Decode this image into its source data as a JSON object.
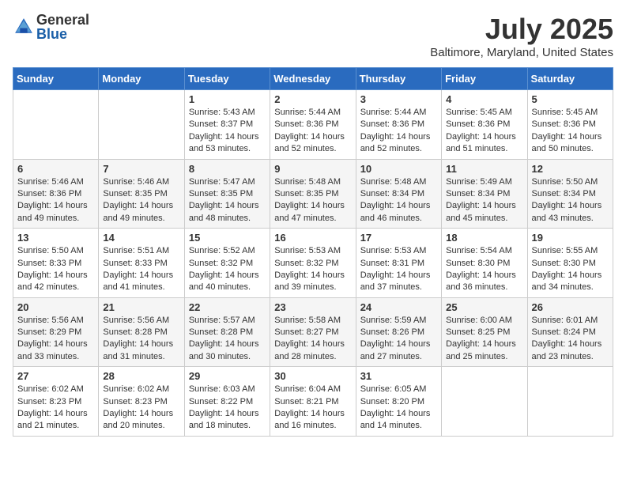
{
  "logo": {
    "general": "General",
    "blue": "Blue"
  },
  "title": "July 2025",
  "location": "Baltimore, Maryland, United States",
  "days_of_week": [
    "Sunday",
    "Monday",
    "Tuesday",
    "Wednesday",
    "Thursday",
    "Friday",
    "Saturday"
  ],
  "weeks": [
    [
      {
        "day": null,
        "sunrise": null,
        "sunset": null,
        "daylight": null
      },
      {
        "day": null,
        "sunrise": null,
        "sunset": null,
        "daylight": null
      },
      {
        "day": "1",
        "sunrise": "5:43 AM",
        "sunset": "8:37 PM",
        "daylight": "14 hours and 53 minutes."
      },
      {
        "day": "2",
        "sunrise": "5:44 AM",
        "sunset": "8:36 PM",
        "daylight": "14 hours and 52 minutes."
      },
      {
        "day": "3",
        "sunrise": "5:44 AM",
        "sunset": "8:36 PM",
        "daylight": "14 hours and 52 minutes."
      },
      {
        "day": "4",
        "sunrise": "5:45 AM",
        "sunset": "8:36 PM",
        "daylight": "14 hours and 51 minutes."
      },
      {
        "day": "5",
        "sunrise": "5:45 AM",
        "sunset": "8:36 PM",
        "daylight": "14 hours and 50 minutes."
      }
    ],
    [
      {
        "day": "6",
        "sunrise": "5:46 AM",
        "sunset": "8:36 PM",
        "daylight": "14 hours and 49 minutes."
      },
      {
        "day": "7",
        "sunrise": "5:46 AM",
        "sunset": "8:35 PM",
        "daylight": "14 hours and 49 minutes."
      },
      {
        "day": "8",
        "sunrise": "5:47 AM",
        "sunset": "8:35 PM",
        "daylight": "14 hours and 48 minutes."
      },
      {
        "day": "9",
        "sunrise": "5:48 AM",
        "sunset": "8:35 PM",
        "daylight": "14 hours and 47 minutes."
      },
      {
        "day": "10",
        "sunrise": "5:48 AM",
        "sunset": "8:34 PM",
        "daylight": "14 hours and 46 minutes."
      },
      {
        "day": "11",
        "sunrise": "5:49 AM",
        "sunset": "8:34 PM",
        "daylight": "14 hours and 45 minutes."
      },
      {
        "day": "12",
        "sunrise": "5:50 AM",
        "sunset": "8:34 PM",
        "daylight": "14 hours and 43 minutes."
      }
    ],
    [
      {
        "day": "13",
        "sunrise": "5:50 AM",
        "sunset": "8:33 PM",
        "daylight": "14 hours and 42 minutes."
      },
      {
        "day": "14",
        "sunrise": "5:51 AM",
        "sunset": "8:33 PM",
        "daylight": "14 hours and 41 minutes."
      },
      {
        "day": "15",
        "sunrise": "5:52 AM",
        "sunset": "8:32 PM",
        "daylight": "14 hours and 40 minutes."
      },
      {
        "day": "16",
        "sunrise": "5:53 AM",
        "sunset": "8:32 PM",
        "daylight": "14 hours and 39 minutes."
      },
      {
        "day": "17",
        "sunrise": "5:53 AM",
        "sunset": "8:31 PM",
        "daylight": "14 hours and 37 minutes."
      },
      {
        "day": "18",
        "sunrise": "5:54 AM",
        "sunset": "8:30 PM",
        "daylight": "14 hours and 36 minutes."
      },
      {
        "day": "19",
        "sunrise": "5:55 AM",
        "sunset": "8:30 PM",
        "daylight": "14 hours and 34 minutes."
      }
    ],
    [
      {
        "day": "20",
        "sunrise": "5:56 AM",
        "sunset": "8:29 PM",
        "daylight": "14 hours and 33 minutes."
      },
      {
        "day": "21",
        "sunrise": "5:56 AM",
        "sunset": "8:28 PM",
        "daylight": "14 hours and 31 minutes."
      },
      {
        "day": "22",
        "sunrise": "5:57 AM",
        "sunset": "8:28 PM",
        "daylight": "14 hours and 30 minutes."
      },
      {
        "day": "23",
        "sunrise": "5:58 AM",
        "sunset": "8:27 PM",
        "daylight": "14 hours and 28 minutes."
      },
      {
        "day": "24",
        "sunrise": "5:59 AM",
        "sunset": "8:26 PM",
        "daylight": "14 hours and 27 minutes."
      },
      {
        "day": "25",
        "sunrise": "6:00 AM",
        "sunset": "8:25 PM",
        "daylight": "14 hours and 25 minutes."
      },
      {
        "day": "26",
        "sunrise": "6:01 AM",
        "sunset": "8:24 PM",
        "daylight": "14 hours and 23 minutes."
      }
    ],
    [
      {
        "day": "27",
        "sunrise": "6:02 AM",
        "sunset": "8:23 PM",
        "daylight": "14 hours and 21 minutes."
      },
      {
        "day": "28",
        "sunrise": "6:02 AM",
        "sunset": "8:23 PM",
        "daylight": "14 hours and 20 minutes."
      },
      {
        "day": "29",
        "sunrise": "6:03 AM",
        "sunset": "8:22 PM",
        "daylight": "14 hours and 18 minutes."
      },
      {
        "day": "30",
        "sunrise": "6:04 AM",
        "sunset": "8:21 PM",
        "daylight": "14 hours and 16 minutes."
      },
      {
        "day": "31",
        "sunrise": "6:05 AM",
        "sunset": "8:20 PM",
        "daylight": "14 hours and 14 minutes."
      },
      {
        "day": null,
        "sunrise": null,
        "sunset": null,
        "daylight": null
      },
      {
        "day": null,
        "sunrise": null,
        "sunset": null,
        "daylight": null
      }
    ]
  ]
}
